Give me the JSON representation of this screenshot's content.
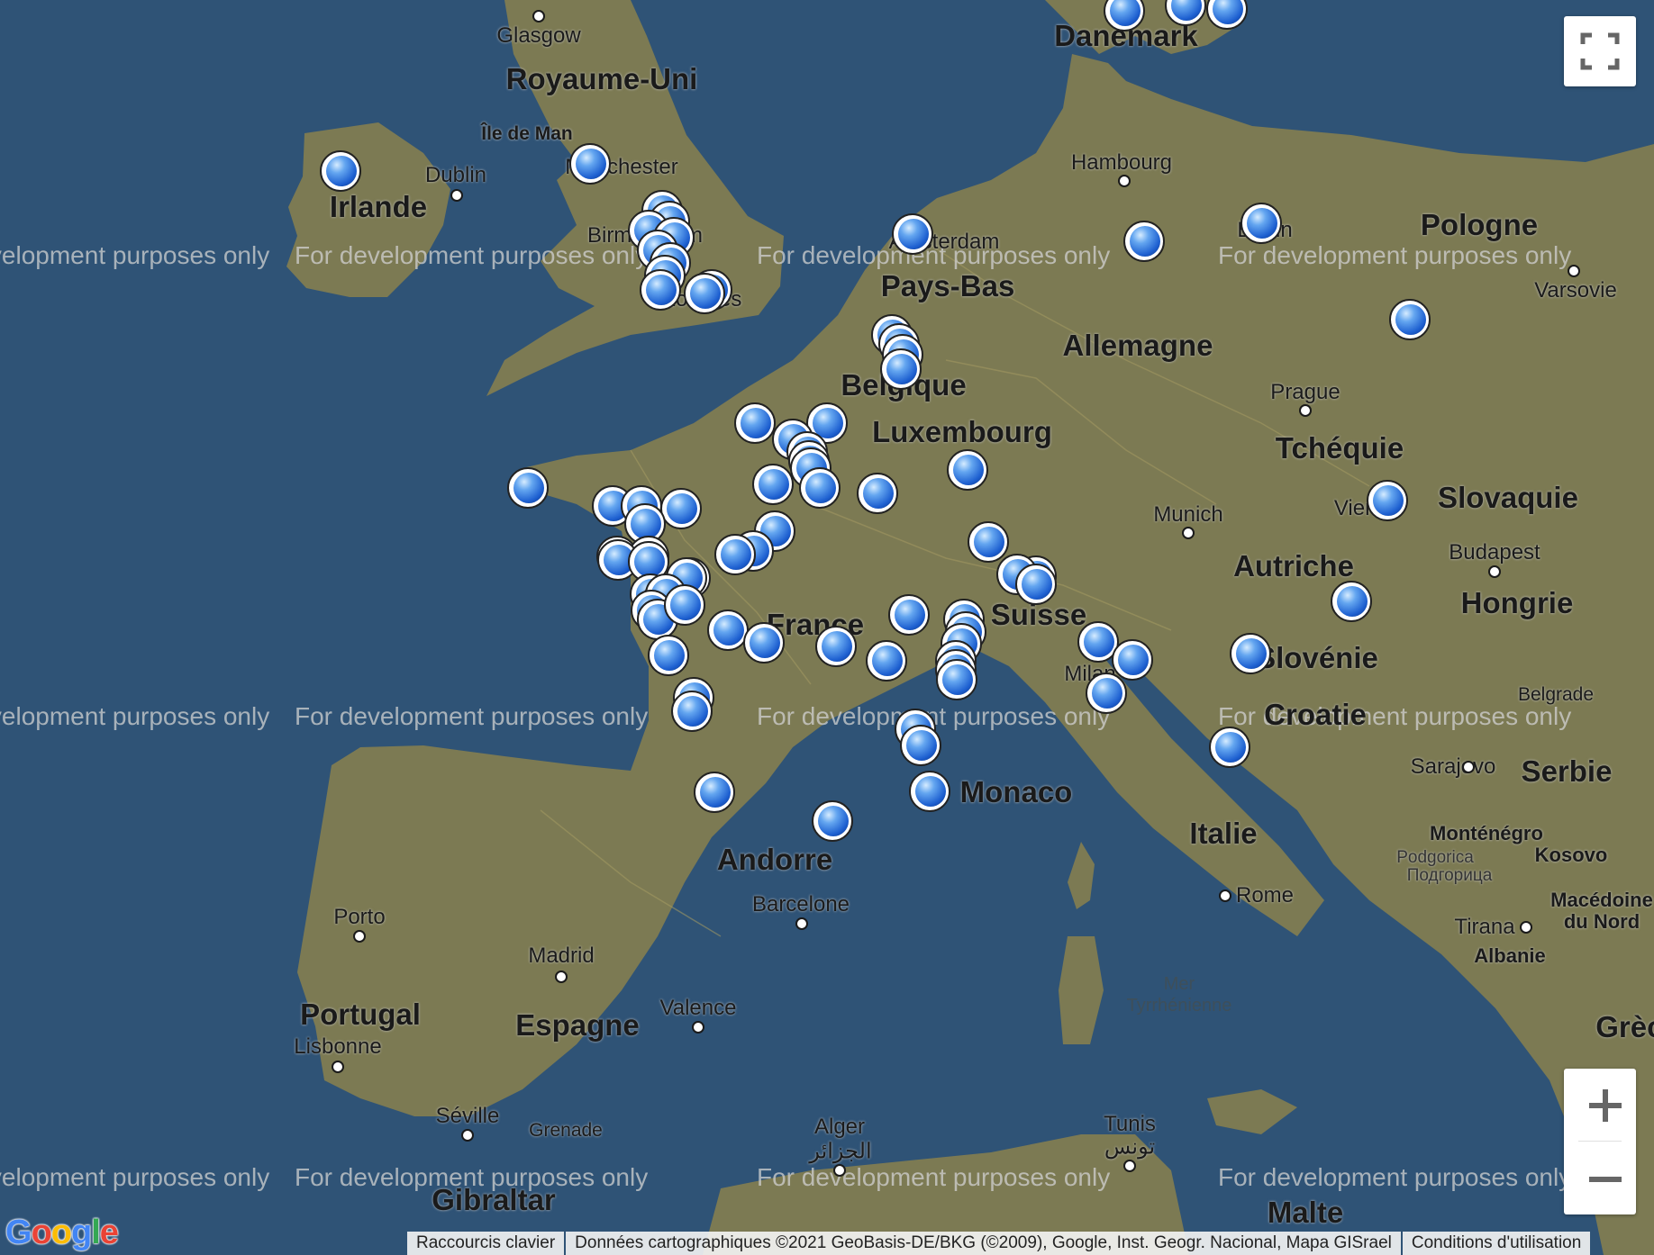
{
  "map": {
    "countries": [
      {
        "name": "Royaume-Uni"
      },
      {
        "name": "Irlande"
      },
      {
        "name": "Danemark"
      },
      {
        "name": "Pays-Bas"
      },
      {
        "name": "Allemagne"
      },
      {
        "name": "Pologne"
      },
      {
        "name": "Belgique"
      },
      {
        "name": "Luxembourg"
      },
      {
        "name": "Tchéquie"
      },
      {
        "name": "Slovaquie"
      },
      {
        "name": "Autriche"
      },
      {
        "name": "Hongrie"
      },
      {
        "name": "France"
      },
      {
        "name": "Suisse"
      },
      {
        "name": "Slovénie"
      },
      {
        "name": "Croatie"
      },
      {
        "name": "Serbie"
      },
      {
        "name": "Monaco"
      },
      {
        "name": "Italie"
      },
      {
        "name": "Andorre"
      },
      {
        "name": "Portugal"
      },
      {
        "name": "Espagne"
      },
      {
        "name": "Gibraltar"
      },
      {
        "name": "Malte"
      },
      {
        "name": "Monténégro"
      },
      {
        "name": "Kosovo"
      },
      {
        "name": "Macédoine du Nord"
      },
      {
        "name": "Albanie"
      },
      {
        "name": "Grèce"
      }
    ],
    "cities": [
      {
        "name": "Glasgow"
      },
      {
        "name": "Île de Man"
      },
      {
        "name": "Dublin"
      },
      {
        "name": "Manchester"
      },
      {
        "name": "Birmingham"
      },
      {
        "name": "Londres"
      },
      {
        "name": "Amsterdam"
      },
      {
        "name": "Hambourg"
      },
      {
        "name": "Berlin"
      },
      {
        "name": "Varsovie"
      },
      {
        "name": "Prague"
      },
      {
        "name": "Munich"
      },
      {
        "name": "Vienne"
      },
      {
        "name": "Budapest"
      },
      {
        "name": "Milan"
      },
      {
        "name": "Belgrade"
      },
      {
        "name": "Sarajevo"
      },
      {
        "name": "Podgorica"
      },
      {
        "name": "Подгорица"
      },
      {
        "name": "Rome"
      },
      {
        "name": "Tirana"
      },
      {
        "name": "Barcelone"
      },
      {
        "name": "Porto"
      },
      {
        "name": "Madrid"
      },
      {
        "name": "Valence"
      },
      {
        "name": "Lisbonne"
      },
      {
        "name": "Séville"
      },
      {
        "name": "Grenade"
      },
      {
        "name": "Alger"
      },
      {
        "name": "الجزائر"
      },
      {
        "name": "Tunis"
      },
      {
        "name": "تونس"
      }
    ],
    "seas": [
      {
        "name": "Mer Tyrrhénienne"
      }
    ],
    "watermark_text": "For development purposes only",
    "marker_count": 83,
    "colors": {
      "sea": "#2f5376",
      "land": "#7c7a53",
      "marker": "#2a6fe0"
    }
  },
  "controls": {
    "fullscreen": {
      "icon": "fullscreen-icon"
    },
    "zoom_in": {
      "label": "+"
    },
    "zoom_out": {
      "label": "−"
    }
  },
  "footer": {
    "shortcuts": "Raccourcis clavier",
    "attribution": "Données cartographiques ©2021 GeoBasis-DE/BKG (©2009), Google, Inst. Geogr. Nacional, Mapa GISrael",
    "terms": "Conditions d'utilisation"
  },
  "logo": {
    "text": "Google"
  }
}
